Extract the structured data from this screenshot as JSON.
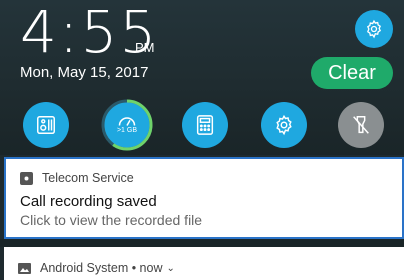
{
  "status": {
    "time": "4:55",
    "ampm": "PM",
    "date": "Mon, May 15, 2017"
  },
  "actions": {
    "clear_label": "Clear"
  },
  "quick_settings": [
    {
      "name": "equalizer-icon",
      "state": "on"
    },
    {
      "name": "boost-icon",
      "label": ">1 GB",
      "state": "on"
    },
    {
      "name": "calculator-icon",
      "state": "on"
    },
    {
      "name": "settings-icon",
      "state": "on"
    },
    {
      "name": "flashlight-icon",
      "state": "off"
    }
  ],
  "notifications": [
    {
      "app": "Telecom Service",
      "icon": "recorder-icon",
      "title": "Call recording saved",
      "text": "Click to view the recorded file"
    },
    {
      "app": "Android System • now",
      "icon": "image-icon"
    }
  ],
  "colors": {
    "accent_blue": "#1fa8e0",
    "clear_green": "#1faa6a",
    "boost_ring": "#6fd36a",
    "focus_border": "#2a73c8"
  }
}
